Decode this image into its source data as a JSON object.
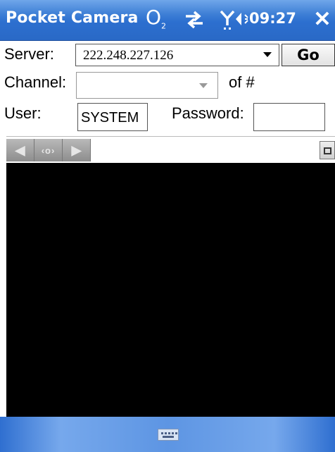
{
  "titlebar": {
    "app_title": "Pocket Camera",
    "operator_logo": "O",
    "operator_sub": "2",
    "time": "09:27",
    "close_label": "✕",
    "icons": [
      "o2-logo-icon",
      "connectivity-arrows-icon",
      "signal-antenna-icon",
      "speaker-volume-icon",
      "close-icon"
    ]
  },
  "form": {
    "server_label": "Server:",
    "server_value": "222.248.227.126",
    "go_label": "Go",
    "channel_label": "Channel:",
    "channel_value": "",
    "of_label": "of #",
    "user_label": "User:",
    "user_value": "SYSTEM",
    "password_label": "Password:",
    "password_value": ""
  },
  "nav": {
    "left_label": "◀",
    "center_label": "‹o›",
    "right_label": "▶",
    "icons": [
      "pan-left-icon",
      "pan-center-icon",
      "pan-right-icon",
      "popout-window-icon"
    ]
  },
  "bottombar": {
    "icons": [
      "keyboard-icon"
    ]
  },
  "colors": {
    "titlebar": "#3e7fd6",
    "video_bg": "#000000"
  }
}
